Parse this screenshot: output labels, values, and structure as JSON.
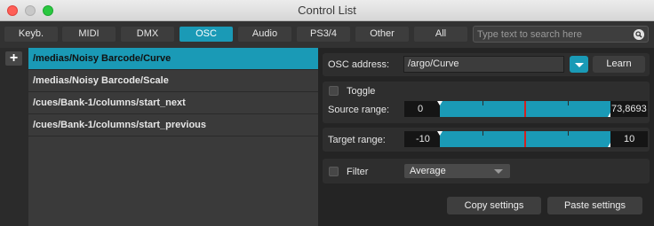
{
  "window": {
    "title": "Control List"
  },
  "tabs": [
    {
      "label": "Keyb.",
      "active": false
    },
    {
      "label": "MIDI",
      "active": false
    },
    {
      "label": "DMX",
      "active": false
    },
    {
      "label": "OSC",
      "active": true
    },
    {
      "label": "Audio",
      "active": false
    },
    {
      "label": "PS3/4",
      "active": false
    },
    {
      "label": "Other",
      "active": false
    },
    {
      "label": "All",
      "active": false
    }
  ],
  "search": {
    "placeholder": "Type text to search here"
  },
  "add_label": "+",
  "list": [
    {
      "label": "/medias/Noisy Barcode/Curve",
      "selected": true
    },
    {
      "label": "/medias/Noisy Barcode/Scale",
      "selected": false
    },
    {
      "label": "/cues/Bank-1/columns/start_next",
      "selected": false
    },
    {
      "label": "/cues/Bank-1/columns/start_previous",
      "selected": false
    }
  ],
  "osc": {
    "address_label": "OSC address:",
    "address_value": "/argo/Curve",
    "learn_label": "Learn"
  },
  "toggle": {
    "label": "Toggle",
    "checked": false
  },
  "source_range": {
    "label": "Source range:",
    "min": "0",
    "max": "73,8693"
  },
  "target_range": {
    "label": "Target range:",
    "min": "-10",
    "max": "10"
  },
  "filter": {
    "label": "Filter",
    "checked": false,
    "mode": "Average"
  },
  "actions": {
    "copy_label": "Copy settings",
    "paste_label": "Paste settings"
  },
  "colors": {
    "accent": "#1a9ab6",
    "marker": "#d42020"
  }
}
